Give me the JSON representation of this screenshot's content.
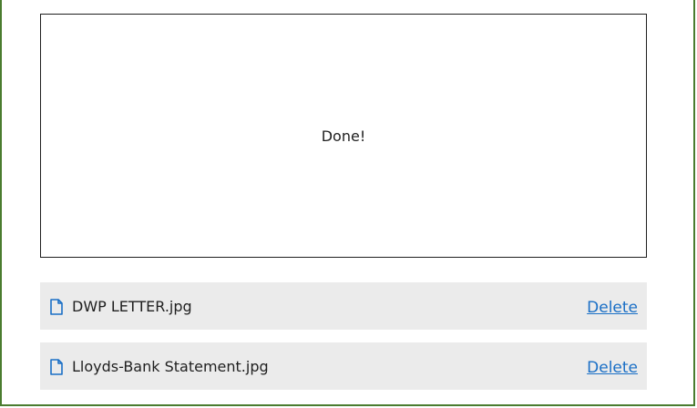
{
  "dropzone": {
    "status": "Done!"
  },
  "files": [
    {
      "name": "DWP LETTER.jpg",
      "action": "Delete",
      "icon": "file-icon"
    },
    {
      "name": "Lloyds-Bank Statement.jpg",
      "action": "Delete",
      "icon": "file-icon"
    }
  ],
  "colors": {
    "frame_border": "#4a7c2f",
    "row_background": "#ebebeb",
    "link": "#1a6fc6",
    "icon": "#1a6fc6"
  }
}
